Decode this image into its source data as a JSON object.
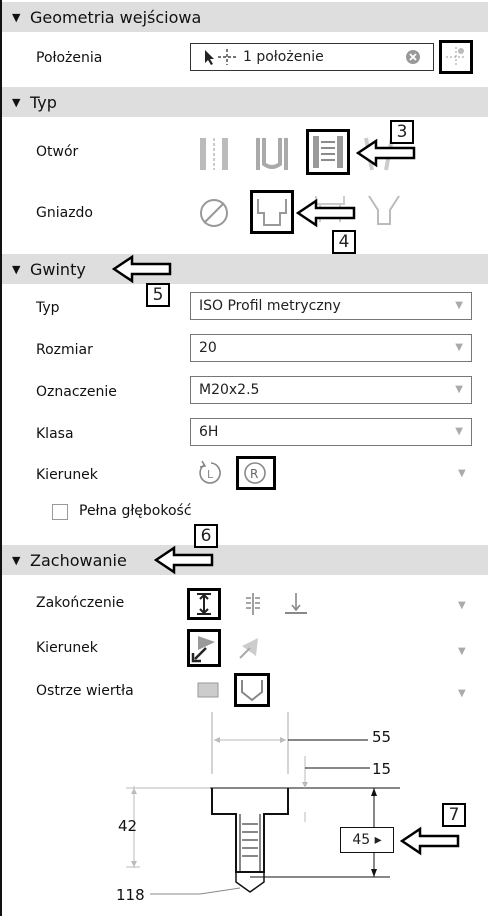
{
  "sections": {
    "geom": "Geometria wejściowa",
    "typ": "Typ",
    "gwinty": "Gwinty",
    "zach": "Zachowanie"
  },
  "geom": {
    "positions_label": "Położenia",
    "positions_value": "1 położenie"
  },
  "typ": {
    "otwor_label": "Otwór",
    "gniazdo_label": "Gniazdo"
  },
  "gwinty": {
    "typ_label": "Typ",
    "typ_value": "ISO Profil metryczny",
    "rozmiar_label": "Rozmiar",
    "rozmiar_value": "20",
    "oznaczenie_label": "Oznaczenie",
    "oznaczenie_value": "M20x2.5",
    "klasa_label": "Klasa",
    "klasa_value": "6H",
    "kierunek_label": "Kierunek",
    "pelna_label": "Pełna głębokość"
  },
  "zach": {
    "zakonczenie_label": "Zakończenie",
    "kierunek_label": "Kierunek",
    "ostrze_label": "Ostrze wiertła"
  },
  "dims": {
    "d55": "55",
    "d15": "15",
    "d42": "42",
    "d45": "45 ▸",
    "d118": "118"
  },
  "callouts": [
    "3",
    "4",
    "5",
    "6",
    "7"
  ]
}
